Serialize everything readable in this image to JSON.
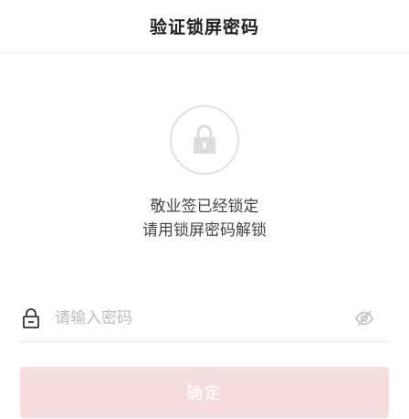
{
  "header": {
    "title": "验证锁屏密码"
  },
  "message": {
    "line1": "敬业签已经锁定",
    "line2": "请用锁屏密码解锁"
  },
  "password": {
    "placeholder": "请输入密码",
    "value": ""
  },
  "confirm_label": "确定",
  "icons": {
    "hero": "lock-icon",
    "field": "lock-icon",
    "toggle": "eye-off-icon"
  },
  "colors": {
    "button_bg": "#f6dcdc",
    "button_text": "#ffffff",
    "hero_icon": "#dcdcdc",
    "placeholder": "#bdbdbd"
  }
}
